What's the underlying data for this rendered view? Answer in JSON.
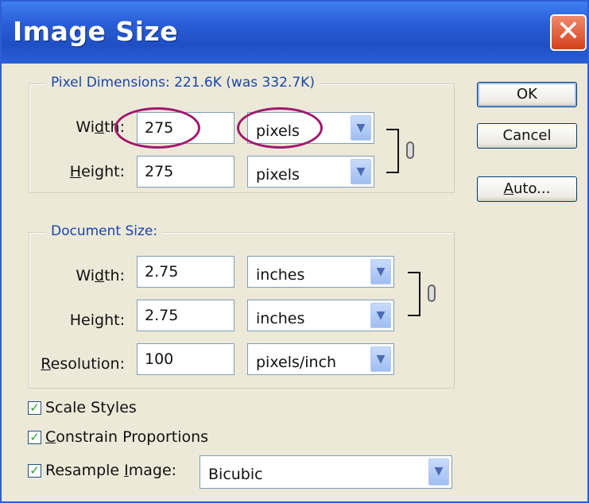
{
  "window": {
    "title": "Image Size",
    "close_glyph": "✕"
  },
  "pixel_dimensions": {
    "legend": "Pixel Dimensions:  221.6K (was 332.7K)",
    "width": {
      "label": "Width:",
      "value": "275",
      "unit": "pixels"
    },
    "height": {
      "label": "Height:",
      "value": "275",
      "unit": "pixels"
    }
  },
  "document_size": {
    "legend": "Document Size:",
    "width": {
      "label": "Width:",
      "value": "2.75",
      "unit": "inches"
    },
    "height": {
      "label": "Height:",
      "value": "2.75",
      "unit": "inches"
    },
    "resolution": {
      "label": "Resolution:",
      "value": "100",
      "unit": "pixels/inch"
    }
  },
  "options": {
    "scale_styles": {
      "label": "Scale Styles",
      "checked": true
    },
    "constrain_proportions": {
      "label": "Constrain Proportions",
      "checked": true
    },
    "resample_image": {
      "label": "Resample Image:",
      "checked": true,
      "method": "Bicubic"
    }
  },
  "buttons": {
    "ok": "OK",
    "cancel": "Cancel",
    "auto": "Auto..."
  },
  "icons": {
    "dropdown": "chevron-down-icon",
    "checkmark": "check-icon",
    "link": "chain-link-icon"
  },
  "colors": {
    "titlebar": "#2a5ed8",
    "highlight_oval": "#a0186e",
    "legend_text": "#1a45a8"
  }
}
